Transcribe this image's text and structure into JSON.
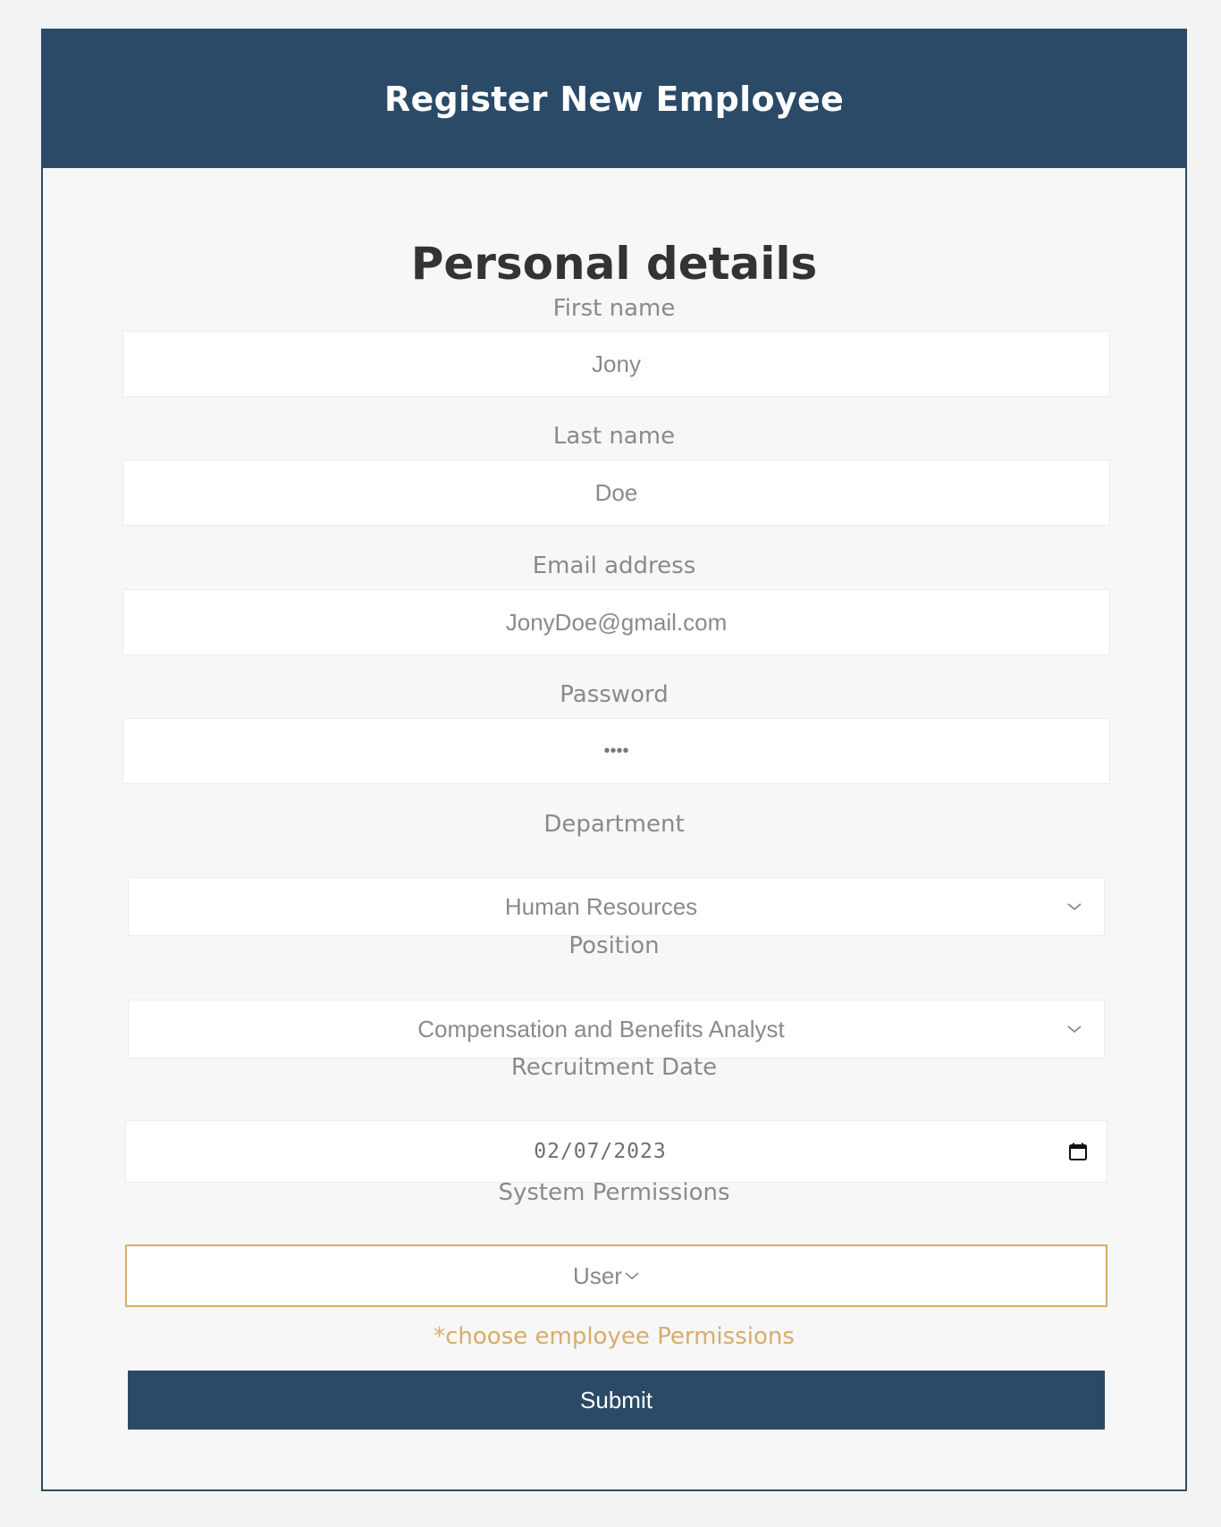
{
  "header": {
    "title": "Register New Employee"
  },
  "form": {
    "section_title": "Personal details",
    "first_name": {
      "label": "First name",
      "value": "Jony"
    },
    "last_name": {
      "label": "Last name",
      "value": "Doe"
    },
    "email": {
      "label": "Email address",
      "value": "JonyDoe@gmail.com"
    },
    "password": {
      "label": "Password",
      "value": "••••"
    },
    "department": {
      "label": "Department",
      "selected": "Human Resources"
    },
    "position": {
      "label": "Position",
      "selected": "Compensation and Benefits Analyst"
    },
    "recruitment_date": {
      "label": "Recruitment Date",
      "value": "02/07/2023"
    },
    "permissions": {
      "label": "System Permissions",
      "selected": "User",
      "hint": "*choose employee Permissions"
    },
    "submit_label": "Submit"
  },
  "colors": {
    "primary": "#2b4a67",
    "accent": "#d6ad6b",
    "page_bg": "#f3f3f3",
    "card_bg": "#f7f7f7",
    "label_text": "#8a8a8a"
  },
  "icons": {
    "select": "chevron-down-icon",
    "date": "calendar-icon"
  }
}
